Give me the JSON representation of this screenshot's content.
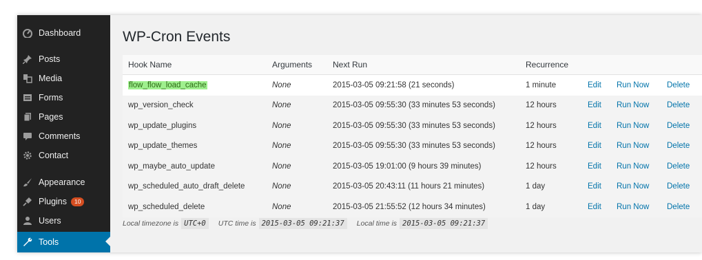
{
  "sidebar": {
    "items": [
      {
        "label": "Dashboard",
        "icon": "dashboard-icon"
      },
      {
        "label": "Posts",
        "icon": "pin-icon"
      },
      {
        "label": "Media",
        "icon": "media-icon"
      },
      {
        "label": "Forms",
        "icon": "forms-icon"
      },
      {
        "label": "Pages",
        "icon": "pages-icon"
      },
      {
        "label": "Comments",
        "icon": "comment-icon"
      },
      {
        "label": "Contact",
        "icon": "gear-icon"
      },
      {
        "label": "Appearance",
        "icon": "brush-icon"
      },
      {
        "label": "Plugins",
        "icon": "plug-icon",
        "badge": "10"
      },
      {
        "label": "Users",
        "icon": "user-icon"
      },
      {
        "label": "Tools",
        "icon": "wrench-icon",
        "active": true
      }
    ]
  },
  "page": {
    "title": "WP-Cron Events"
  },
  "table": {
    "headers": {
      "hook": "Hook Name",
      "args": "Arguments",
      "next": "Next Run",
      "rec": "Recurrence"
    },
    "rows": [
      {
        "hook": "flow_flow_load_cache",
        "args": "None",
        "next": "2015-03-05 09:21:58 (21 seconds)",
        "rec": "1 minute",
        "edit": "Edit",
        "run": "Run Now",
        "del": "Delete",
        "highlight": true
      },
      {
        "hook": "wp_version_check",
        "args": "None",
        "next": "2015-03-05 09:55:30 (33 minutes 53 seconds)",
        "rec": "12 hours",
        "edit": "Edit",
        "run": "Run Now",
        "del": "Delete"
      },
      {
        "hook": "wp_update_plugins",
        "args": "None",
        "next": "2015-03-05 09:55:30 (33 minutes 53 seconds)",
        "rec": "12 hours",
        "edit": "Edit",
        "run": "Run Now",
        "del": "Delete"
      },
      {
        "hook": "wp_update_themes",
        "args": "None",
        "next": "2015-03-05 09:55:30 (33 minutes 53 seconds)",
        "rec": "12 hours",
        "edit": "Edit",
        "run": "Run Now",
        "del": "Delete"
      },
      {
        "hook": "wp_maybe_auto_update",
        "args": "None",
        "next": "2015-03-05 19:01:00 (9 hours 39 minutes)",
        "rec": "12 hours",
        "edit": "Edit",
        "run": "Run Now",
        "del": "Delete"
      },
      {
        "hook": "wp_scheduled_auto_draft_delete",
        "args": "None",
        "next": "2015-03-05 20:43:11 (11 hours 21 minutes)",
        "rec": "1 day",
        "edit": "Edit",
        "run": "Run Now",
        "del": "Delete"
      },
      {
        "hook": "wp_scheduled_delete",
        "args": "None",
        "next": "2015-03-05 21:55:52 (12 hours 34 minutes)",
        "rec": "1 day",
        "edit": "Edit",
        "run": "Run Now",
        "del": "Delete"
      }
    ]
  },
  "footer": {
    "tz_label": "Local timezone is",
    "tz_value": "UTC+0",
    "utc_label": "UTC time is",
    "utc_value": "2015-03-05 09:21:37",
    "local_label": "Local time is",
    "local_value": "2015-03-05 09:21:37"
  },
  "colors": {
    "sidebar": "#222222",
    "active": "#0073aa",
    "link": "#0073aa",
    "highlight": "#9ff08e",
    "badge": "#d54e21"
  }
}
